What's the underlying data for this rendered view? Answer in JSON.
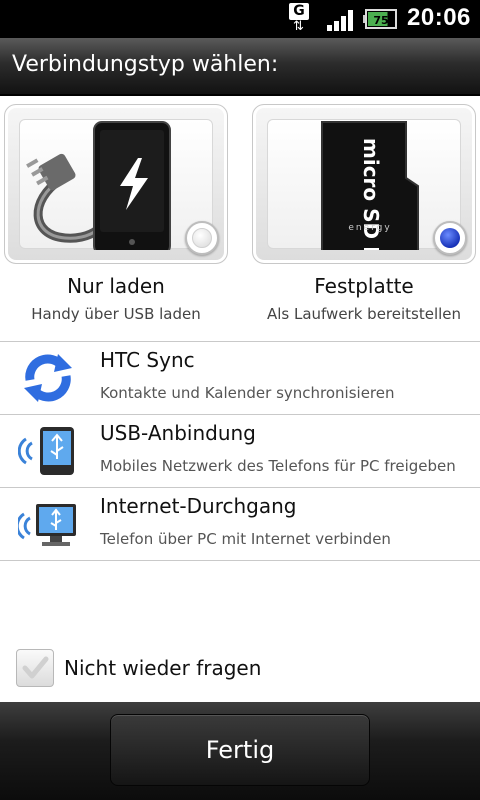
{
  "status_bar": {
    "network_type": "G",
    "data_arrows": "⇅",
    "battery_level": "75",
    "time": "20:06",
    "battery_color": "#4caf50"
  },
  "dialog": {
    "title": "Verbindungstyp wählen:"
  },
  "options": [
    {
      "label": "Nur laden",
      "sublabel": "Handy über USB laden",
      "icon": "charger-phone-icon",
      "selected": false
    },
    {
      "label": "Festplatte",
      "sublabel": "Als Laufwerk bereitstellen",
      "icon": "microsd-card-icon",
      "selected": true,
      "card_text": "micro SD HC",
      "card_brand": "energy"
    }
  ],
  "list": [
    {
      "title": "HTC Sync",
      "subtitle": "Kontakte und Kalender synchronisieren",
      "icon": "sync-arrows-icon"
    },
    {
      "title": "USB-Anbindung",
      "subtitle": "Mobiles Netzwerk des Telefons für PC freigeben",
      "icon": "usb-phone-tether-icon"
    },
    {
      "title": "Internet-Durchgang",
      "subtitle": "Telefon über PC mit Internet verbinden",
      "icon": "usb-pc-passthrough-icon"
    }
  ],
  "checkbox": {
    "label": "Nicht wieder fragen",
    "checked": false
  },
  "footer": {
    "done_label": "Fertig"
  },
  "colors": {
    "radio_selected": "#1832b8",
    "title_bar": "#2c2c2c",
    "sync_blue": "#2f6de0"
  }
}
